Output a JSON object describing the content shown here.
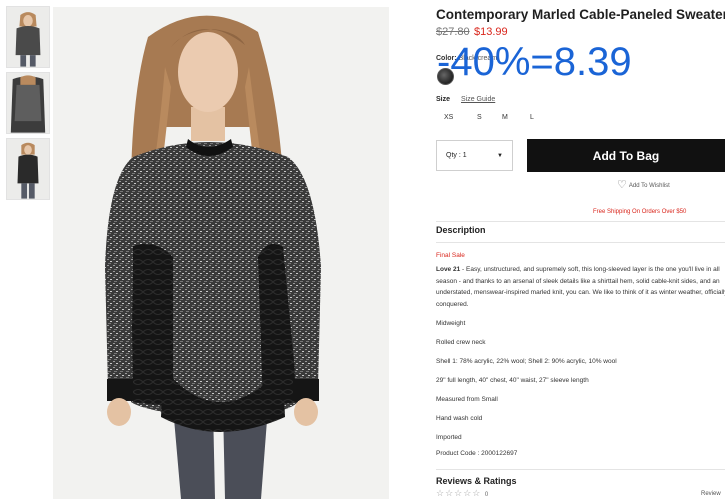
{
  "product": {
    "title": "Contemporary Marled Cable-Paneled Sweater",
    "price_original": "$27.80",
    "price_sale": "$13.99",
    "discount_overlay": "-40%=8.39"
  },
  "color": {
    "label": "Color:",
    "value": "Black/cream"
  },
  "size": {
    "label": "Size",
    "guide": "Size Guide",
    "options": [
      "XS",
      "S",
      "M",
      "L"
    ]
  },
  "purchase": {
    "qty_label": "Qty : 1",
    "add_to_bag": "Add To Bag",
    "wishlist": "Add To Wishlist",
    "shipping_promo": "Free Shipping On Orders Over $50"
  },
  "description": {
    "heading": "Description",
    "final_sale": "Final Sale",
    "brand": "Love 21",
    "body": " - Easy, unstructured, and supremely soft, this long-sleeved layer is the one you'll live in all season - and thanks to an arsenal of sleek details like a shirttail hem, solid cable-knit sides, and an understated, menswear-inspired marled knit, you can. We like to think of it as winter weather, officially conquered.",
    "details": [
      "Midweight",
      "Rolled crew neck",
      "Shell 1: 78% acrylic, 22% wool; Shell 2: 90% acrylic, 10% wool",
      "29\" full length, 40\" chest, 40\" waist, 27\" sleeve length",
      "Measured from Small",
      "Hand wash cold",
      "Imported",
      "Product Code : 2000122697"
    ]
  },
  "reviews": {
    "heading": "Reviews & Ratings",
    "stars": "☆☆☆☆☆",
    "count": "0",
    "link": "Review"
  },
  "colors": {
    "sale_red": "#d9261c",
    "overlay_blue": "#1a64d6",
    "button_black": "#111111"
  }
}
